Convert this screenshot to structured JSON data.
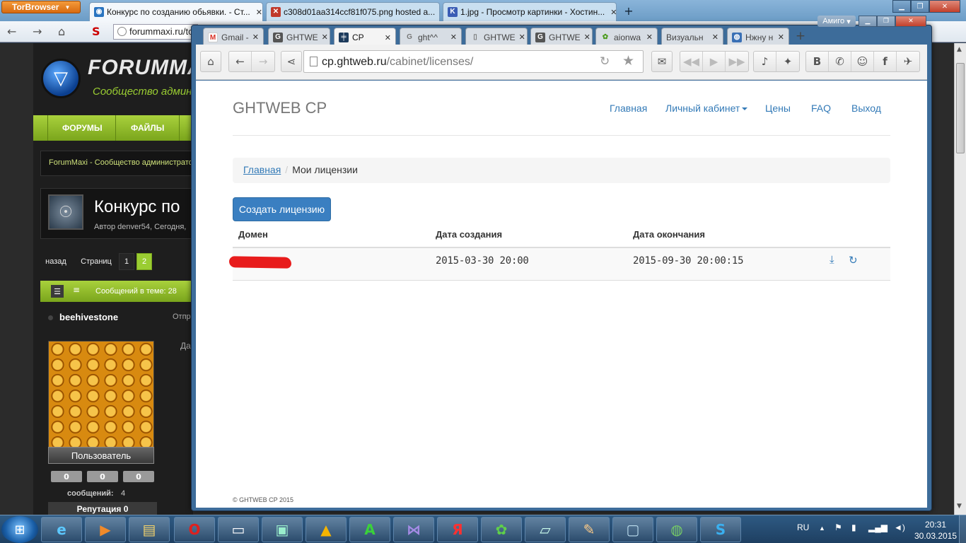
{
  "back_browser": {
    "app_button": "TorBrowser",
    "tabs": [
      {
        "title": "Конкурс по созданию обьявки. - Ст...",
        "icon": "forum-favicon",
        "active": true
      },
      {
        "title": "c308d01aa314ccf81f075.png hosted a...",
        "icon": "vk-favicon",
        "active": false
      },
      {
        "title": "1.jpg - Просмотр картинки - Хостин...",
        "icon": "k-favicon",
        "active": false
      }
    ],
    "url": "forummaxi.ru/to"
  },
  "forum": {
    "logo_text": "FORUMMA",
    "slogan": "Сообщество админ",
    "menu": [
      "ФОРУМЫ",
      "ФАЙЛЫ"
    ],
    "breadcrumb": "ForumMaxi - Сообщество администрато",
    "topic_title": "Конкурс по",
    "topic_author": "Автор denver54, Сегодня,",
    "pager": {
      "back": "назад",
      "pages_label": "Страниц",
      "pages": [
        "1",
        "2"
      ],
      "current": "2"
    },
    "messages_in_topic": "Сообщений в теме: 28",
    "username": "beehivestone",
    "sent_label": "Отпр",
    "date_label": "Да",
    "role": "Пользователь",
    "stats": [
      "0",
      "0",
      "0"
    ],
    "messages_label": "сообщений:",
    "messages_count": "4",
    "reputation": "Репутация 0"
  },
  "front_browser": {
    "profile_button": "Амиго",
    "tabs": [
      {
        "title": "Gmail -",
        "icon": "gmail-favicon",
        "active": false
      },
      {
        "title": "GHTWE",
        "icon": "ght-favicon",
        "active": false
      },
      {
        "title": "CP",
        "icon": "cp-favicon",
        "active": true
      },
      {
        "title": "ght^^",
        "icon": "google-favicon",
        "active": false
      },
      {
        "title": "GHTWE",
        "icon": "document-favicon",
        "active": false
      },
      {
        "title": "GHTWE",
        "icon": "ght-favicon",
        "active": false
      },
      {
        "title": "aionwa",
        "icon": "flower-favicon",
        "active": false
      },
      {
        "title": "Визуальн",
        "icon": "none",
        "active": false
      },
      {
        "title": "Нжну н",
        "icon": "globe-favicon",
        "active": false
      }
    ],
    "url_host": "cp.ghtweb.ru",
    "url_path": "/cabinet/licenses/"
  },
  "page": {
    "brand": "GHTWEB CP",
    "nav": {
      "home": "Главная",
      "cabinet": "Личный кабинет",
      "prices": "Цены",
      "faq": "FAQ",
      "logout": "Выход"
    },
    "breadcrumb": {
      "home": "Главная",
      "current": "Мои лицензии"
    },
    "create_button": "Создать лицензию",
    "table": {
      "headers": [
        "Домен",
        "Дата создания",
        "Дата окончания"
      ],
      "rows": [
        {
          "domain": "",
          "created": "2015-03-30 20:00",
          "expires": "2015-09-30 20:00:15"
        }
      ]
    },
    "footer": "© GHTWEB CP 2015",
    "link_color": "#337ab7",
    "button_color": "#3a7fc1"
  },
  "taskbar": {
    "apps": [
      "internet-explorer-icon",
      "media-player-icon",
      "explorer-folder-icon",
      "opera-icon",
      "console-icon",
      "network-drive-icon",
      "aimp-icon",
      "asterisk-a-icon",
      "visual-studio-icon",
      "yandex-icon",
      "icq-icon",
      "notepad-icon",
      "paint-icon",
      "screen-icon",
      "globe-icon",
      "skype-icon"
    ],
    "language": "RU",
    "time": "20:31",
    "date": "30.03.2015"
  }
}
